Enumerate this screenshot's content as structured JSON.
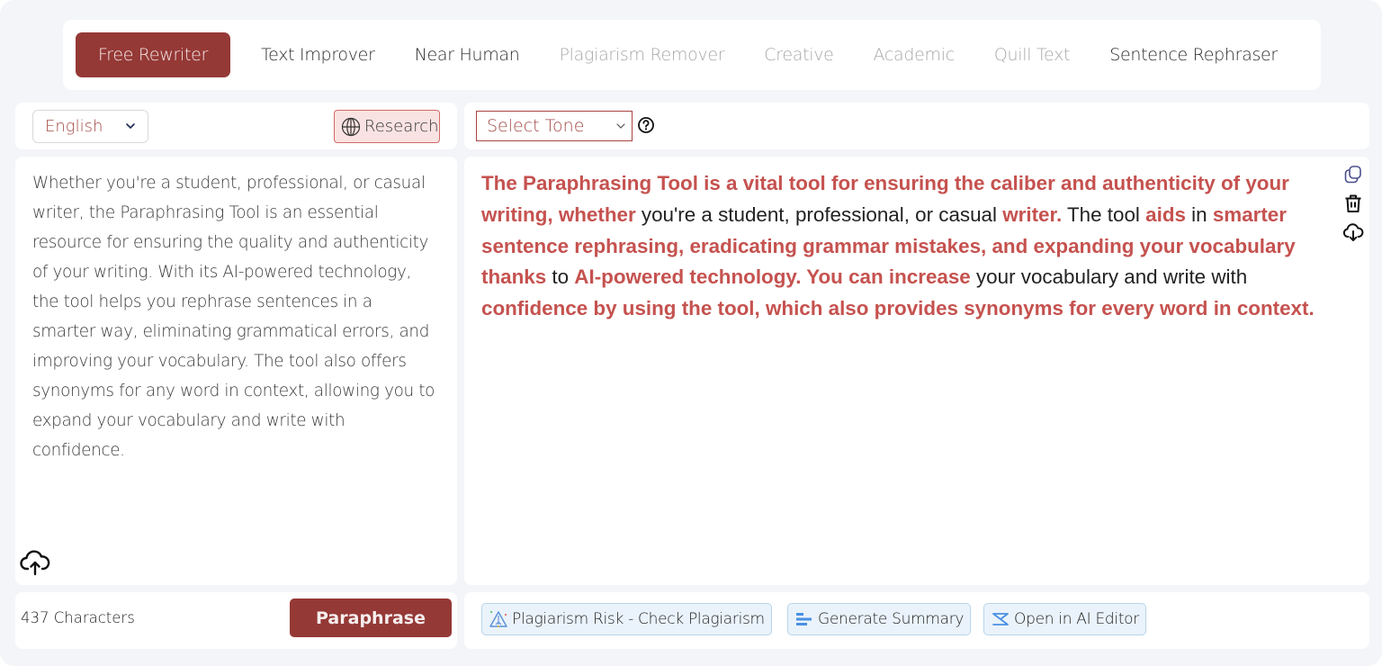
{
  "modes": [
    {
      "label": "Free Rewriter",
      "state": "active"
    },
    {
      "label": "Text Improver",
      "state": "enabled"
    },
    {
      "label": "Near Human",
      "state": "enabled"
    },
    {
      "label": "Plagiarism Remover",
      "state": "disabled"
    },
    {
      "label": "Creative",
      "state": "disabled"
    },
    {
      "label": "Academic",
      "state": "disabled"
    },
    {
      "label": "Quill Text",
      "state": "disabled"
    },
    {
      "label": "Sentence Rephraser",
      "state": "enabled"
    }
  ],
  "input_panel": {
    "language_select": {
      "selected": "English",
      "icon": "chevron-down-icon"
    },
    "research_button": {
      "label": "Research",
      "icon": "globe-icon"
    },
    "text": "Whether you're a student, professional, or casual writer, the Paraphrasing Tool is an essential resource for ensuring the quality and authenticity of your writing. With its AI-powered technology, the tool helps you rephrase sentences in a smarter way, eliminating grammatical errors, and improving your vocabulary. The tool also offers synonyms for any word in context, allowing you to expand your vocabulary and write with confidence.",
    "upload_icon": "cloud-upload-icon",
    "char_count": "437 Characters",
    "paraphrase_button": "Paraphrase"
  },
  "output_panel": {
    "tone_select": {
      "selected": "Select Tone",
      "help_icon": "question-circle-icon"
    },
    "segments": [
      {
        "text": "The Paraphrasing Tool is a vital tool for ensuring the caliber and authenticity of your writing, whether",
        "changed": true
      },
      {
        "text": " you're a student, professional, or casual ",
        "changed": false
      },
      {
        "text": "writer.",
        "changed": true
      },
      {
        "text": " The tool ",
        "changed": false
      },
      {
        "text": "aids",
        "changed": true
      },
      {
        "text": " in ",
        "changed": false
      },
      {
        "text": "smarter sentence rephrasing, eradicating grammar mistakes, and expanding your vocabulary thanks",
        "changed": true
      },
      {
        "text": " to ",
        "changed": false
      },
      {
        "text": "AI-powered technology. You can increase",
        "changed": true
      },
      {
        "text": " your vocabulary and write with ",
        "changed": false
      },
      {
        "text": "confidence by using the tool, which also provides synonyms for every word in context.",
        "changed": true
      }
    ],
    "side_icons": [
      "copy-icon",
      "trash-icon",
      "cloud-download-icon"
    ],
    "actions": [
      {
        "label": "Plagiarism Risk - Check Plagiarism",
        "icon": "warning-triangle-icon"
      },
      {
        "label": "Generate Summary",
        "icon": "summary-bars-icon"
      },
      {
        "label": "Open in AI Editor",
        "icon": "ai-editor-icon"
      }
    ]
  },
  "colors": {
    "brand": "#953936",
    "changed_text": "#c5524f",
    "action_bg": "#eaf3fb",
    "action_border": "#b7d4ea",
    "research_bg": "#f9e3e2"
  }
}
